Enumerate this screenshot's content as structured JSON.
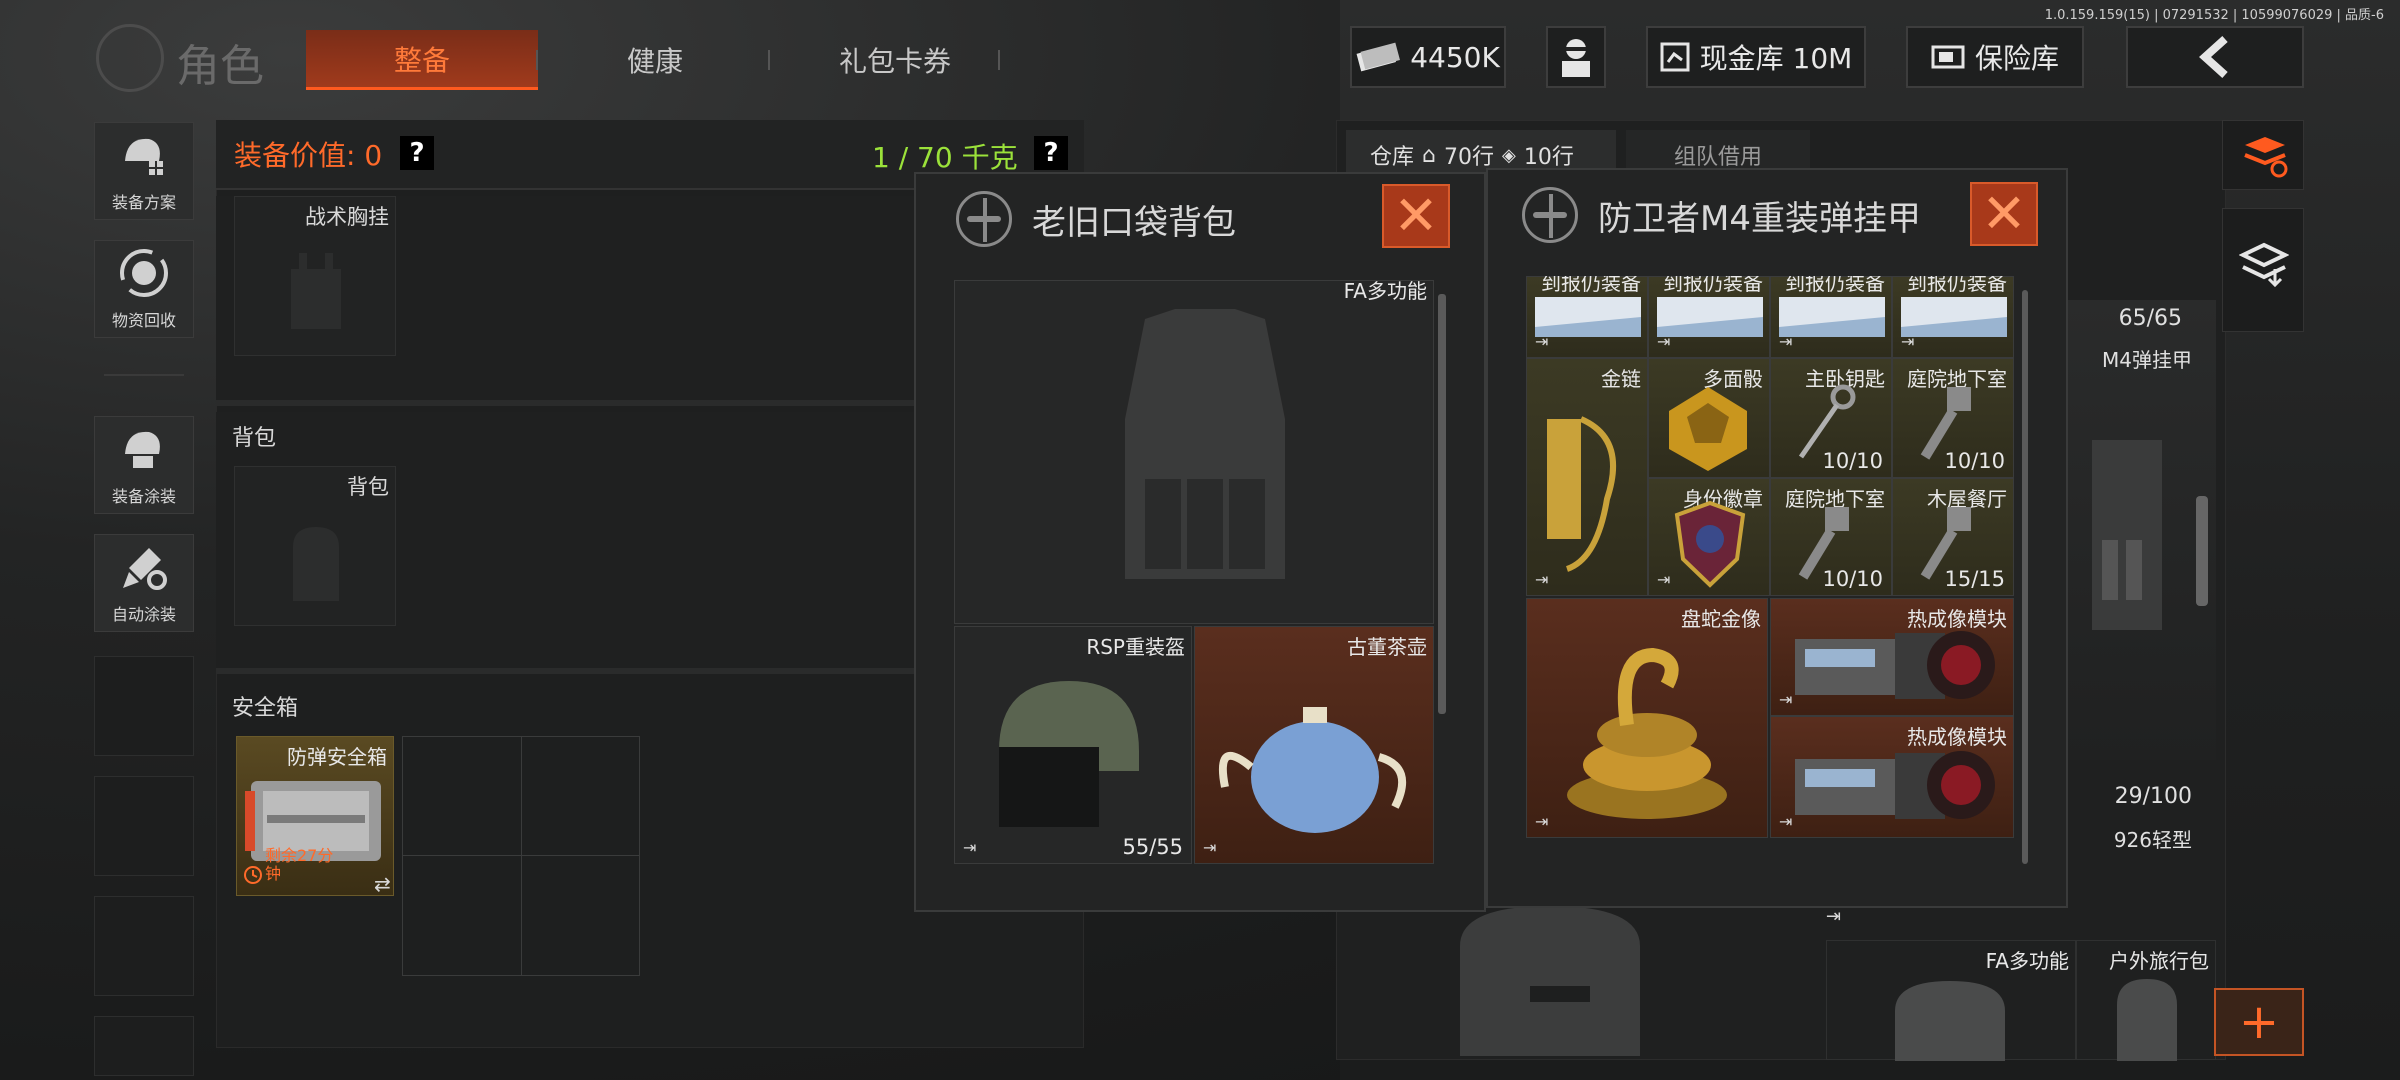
{
  "version": "1.0.159.159(15) | 07291532 | 10599076029 | 品质-6",
  "header": {
    "title": "角色",
    "tabs": [
      {
        "label": "整备"
      },
      {
        "label": "健康"
      },
      {
        "label": "礼包卡券"
      }
    ],
    "money": "4450K",
    "vault_label": "现金库 10M",
    "safe_label": "保险库"
  },
  "sidebar": {
    "items": [
      {
        "label": "装备方案",
        "icon": "gear-plan-icon"
      },
      {
        "label": "物资回收",
        "icon": "recycle-icon"
      },
      {
        "label": "装备涂装",
        "icon": "paint-helmet-icon"
      },
      {
        "label": "自动涂装",
        "icon": "auto-paint-icon"
      }
    ]
  },
  "equip": {
    "value_label": "装备价值: 0",
    "weight": "1 / 70 千克",
    "chest_slot": "战术胸挂",
    "backpack_section": "背包",
    "backpack_slot": "背包",
    "safebox_section": "安全箱",
    "safebox_item": "防弹安全箱",
    "safebox_timer": "剩余27分钟"
  },
  "storage": {
    "tab_warehouse": "仓库",
    "rows_home": "70行",
    "rows_other": "10行",
    "tab_team": "组队借用",
    "vest_count": "65/65",
    "vest_label": "M4弹挂甲",
    "count_2": "29/100",
    "label_2": "926轻型",
    "bag1": "FA多功能",
    "bag2": "户外旅行包"
  },
  "popup_left": {
    "title": "老旧口袋背包",
    "vest_label": "FA多功能",
    "helmet_label": "RSP重装盔",
    "helmet_count": "55/55",
    "teapot_label": "古董茶壶"
  },
  "popup_right": {
    "title": "防卫者M4重装弹挂甲",
    "items": [
      {
        "label": "金链",
        "count": ""
      },
      {
        "label": "多面骰",
        "count": ""
      },
      {
        "label": "主卧钥匙",
        "count": "10/10"
      },
      {
        "label": "庭院地下室",
        "count": "10/10"
      },
      {
        "label": "身份徽章",
        "count": ""
      },
      {
        "label": "庭院地下室",
        "count": "10/10"
      },
      {
        "label": "木屋餐厅",
        "count": "15/15"
      },
      {
        "label": "盘蛇金像",
        "count": ""
      },
      {
        "label": "热成像模块",
        "count": ""
      },
      {
        "label": "热成像模块",
        "count": ""
      }
    ],
    "doc_label": "到报仍装备"
  },
  "colors": {
    "accent": "#ff5a1f",
    "weight_green": "#9be23a",
    "gold_bg": "#3c3a24",
    "rust_bg": "#5a2e1e"
  }
}
